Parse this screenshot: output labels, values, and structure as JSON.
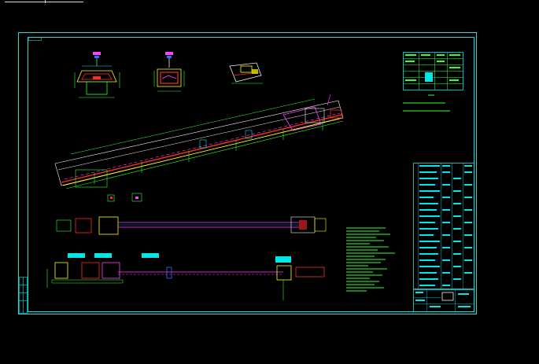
{
  "colors": {
    "background": "#000000",
    "frame": "#00e5e5",
    "part_red": "#ff2a2a",
    "part_magenta": "#ff40ff",
    "part_yellow": "#ffff00",
    "part_green": "#33ff33",
    "part_white": "#f0f0f0",
    "part_blue": "#3a6cff"
  },
  "icons": {
    "tab_marker": "tab-marker-icon"
  }
}
